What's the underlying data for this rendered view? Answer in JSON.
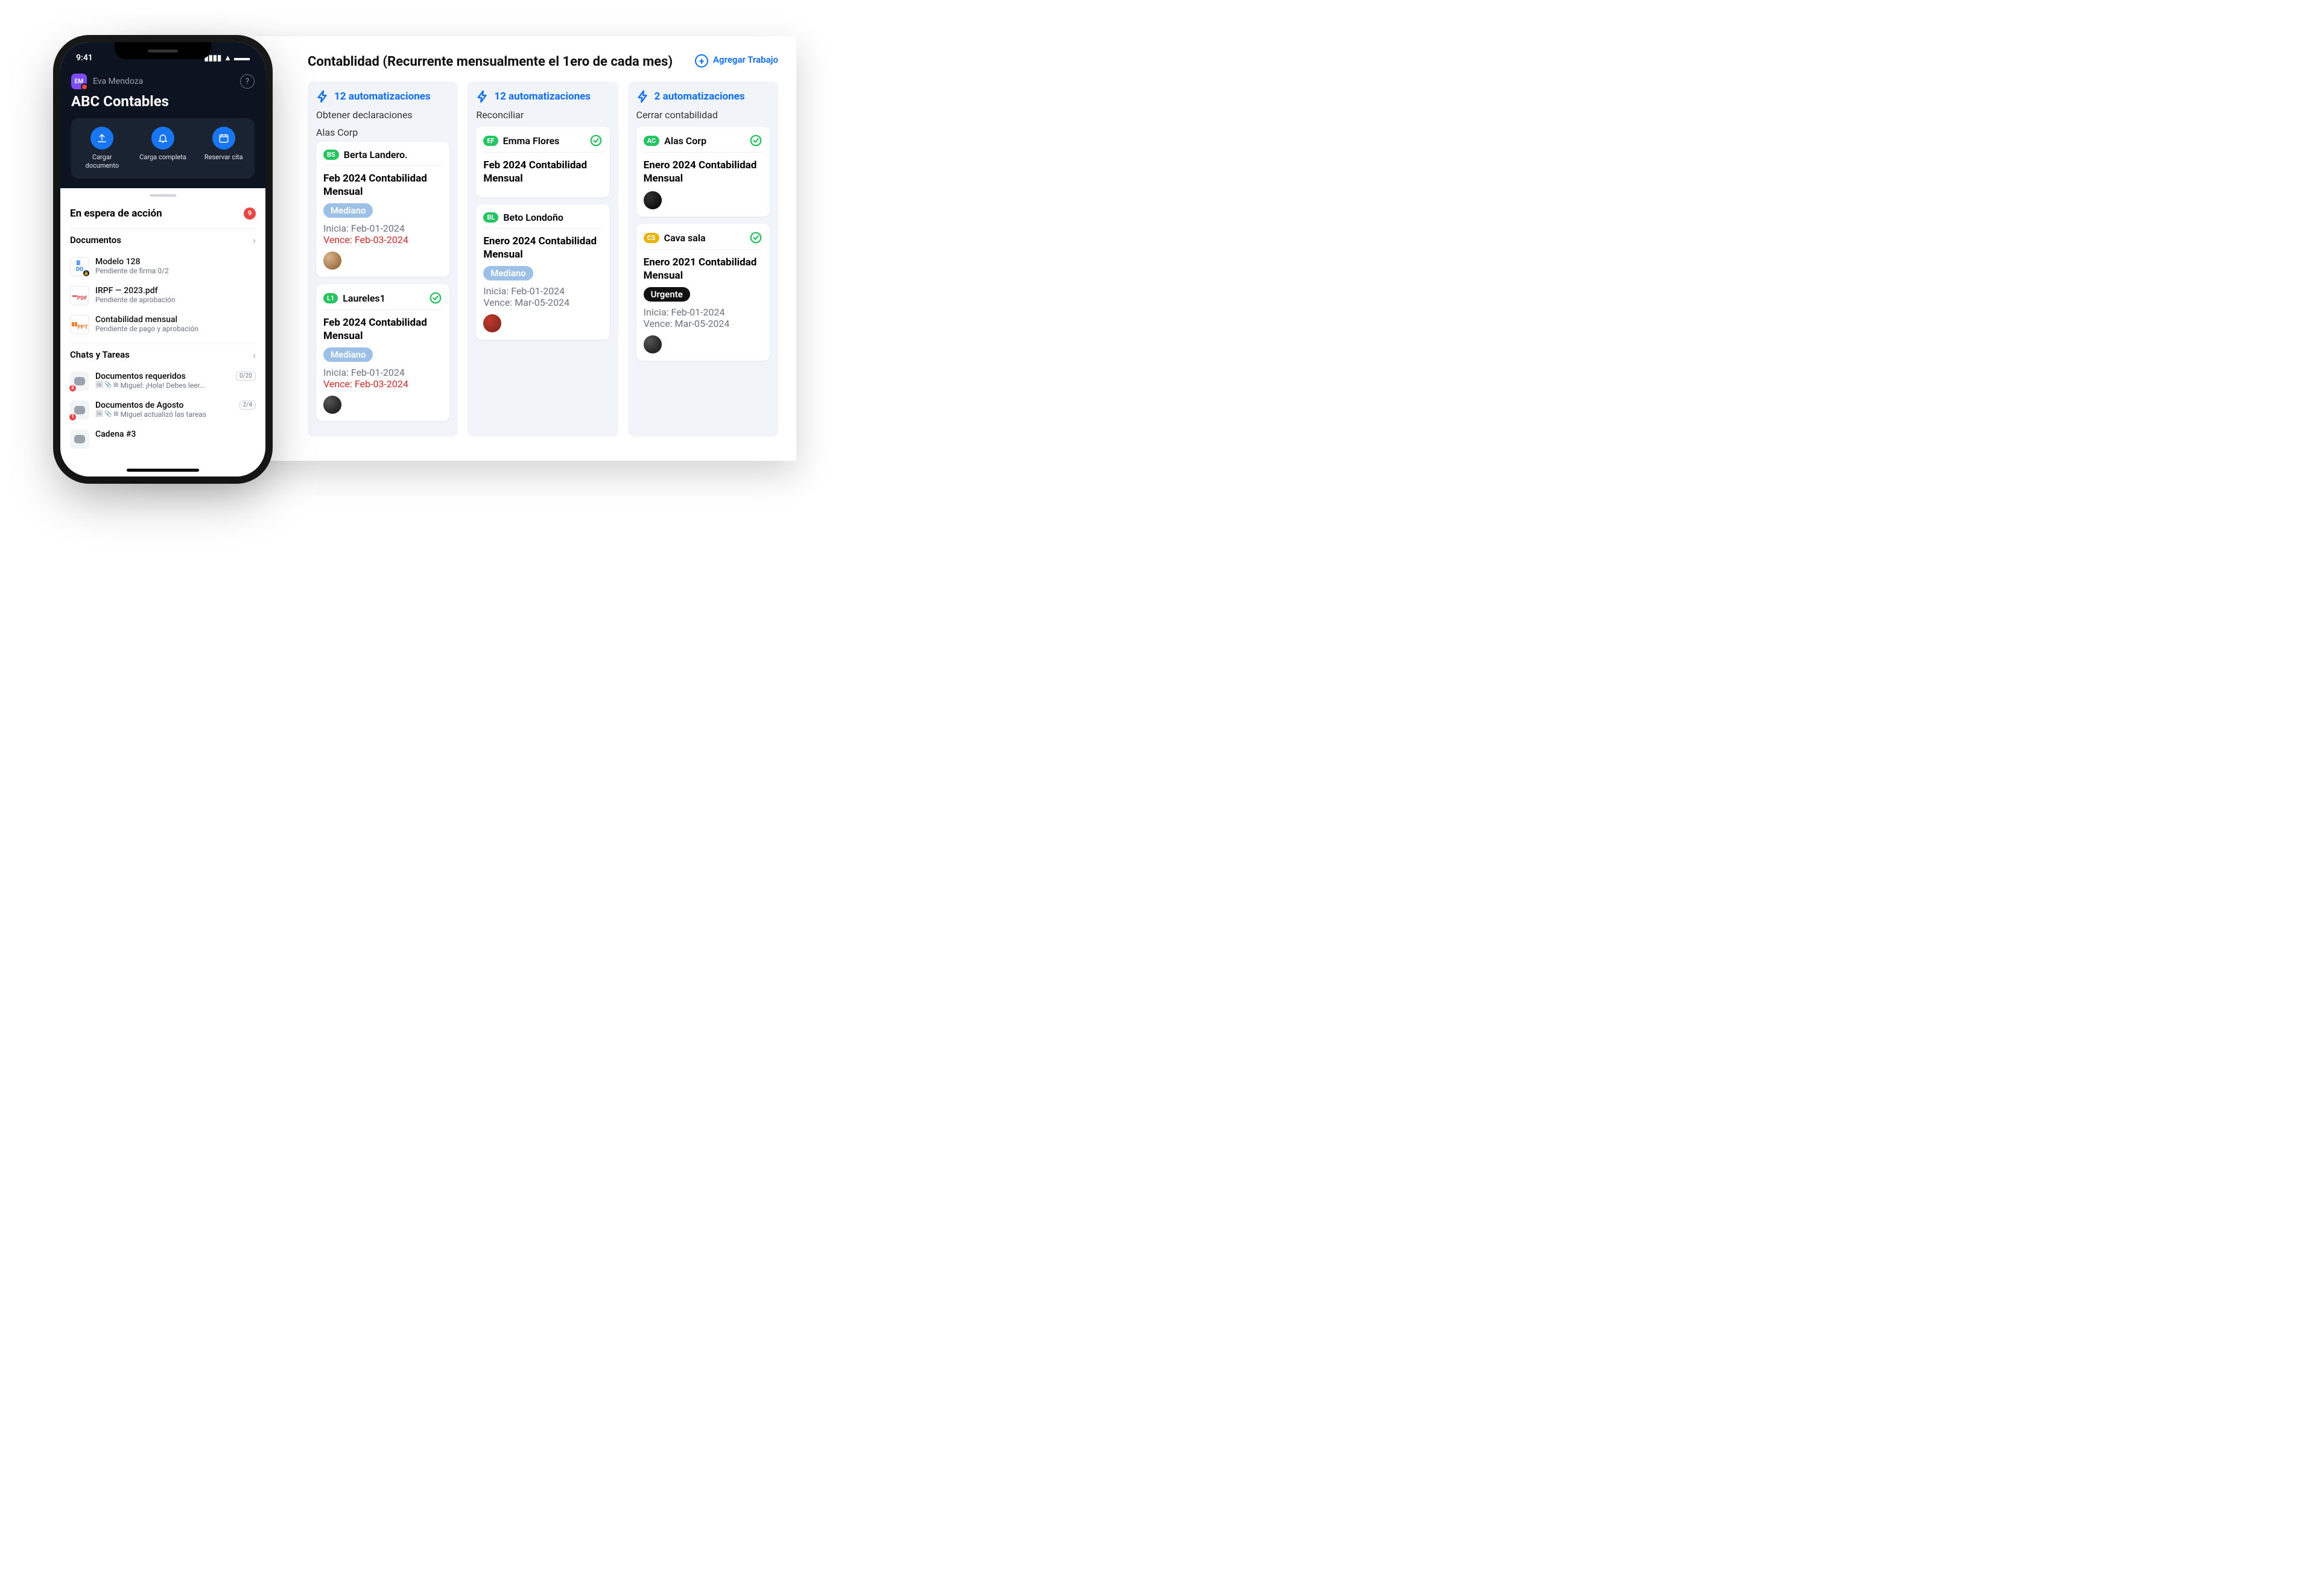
{
  "board": {
    "title": "Contablidad (Recurrente mensualmente el 1ero de cada mes)",
    "add_job": "Agregar Trabajo"
  },
  "columns": [
    {
      "automations": "12 automatizaciones",
      "subtitle": "Obtener declaraciones",
      "group": "Alas Corp",
      "cards": [
        {
          "chip": "BS",
          "chip_style": "green",
          "name": "Berta Landero.",
          "checked": false,
          "title": "Feb 2024 Contabilidad Mensual",
          "tag": "Mediano",
          "tag_style": "med",
          "start": "Inicia: Feb-01-2024",
          "due": "Vence: Feb-03-2024",
          "due_red": true,
          "avatar": "a1"
        },
        {
          "chip": "L1",
          "chip_style": "green",
          "name": "Laureles1",
          "checked": true,
          "title": "Feb 2024 Contabilidad Mensual",
          "tag": "Mediano",
          "tag_style": "med",
          "start": "Inicia: Feb-01-2024",
          "due": "Vence: Feb-03-2024",
          "due_red": true,
          "avatar": "a4"
        }
      ]
    },
    {
      "automations": "12 automatizaciones",
      "subtitle": "Reconciliar",
      "group": "",
      "cards": [
        {
          "chip": "EF",
          "chip_style": "green",
          "name": "Emma Flores",
          "checked": true,
          "title": "Feb 2024 Contabilidad Mensual",
          "tag": "",
          "tag_style": "",
          "start": "",
          "due": "",
          "due_red": false,
          "avatar": ""
        },
        {
          "chip": "BL",
          "chip_style": "green",
          "name": "Beto Londoño",
          "checked": false,
          "title": "Enero 2024 Contabilidad Mensual",
          "tag": "Mediano",
          "tag_style": "med",
          "start": "Inicia: Feb-01-2024",
          "due": "Vence: Mar-05-2024",
          "due_red": false,
          "avatar": "a2"
        }
      ]
    },
    {
      "automations": "2 automatizaciones",
      "subtitle": "Cerrar contabilidad",
      "group": "",
      "cards": [
        {
          "chip": "AC",
          "chip_style": "green",
          "name": "Alas Corp",
          "checked": true,
          "title": "Enero 2024 Contabilidad Mensual",
          "tag": "",
          "tag_style": "",
          "start": "",
          "due": "",
          "due_red": false,
          "avatar": "a3"
        },
        {
          "chip": "CS",
          "chip_style": "yellow",
          "name": "Cava sala",
          "checked": true,
          "title": "Enero 2021 Contabilidad Mensual",
          "tag": "Urgente",
          "tag_style": "urg",
          "start": "Inicia: Feb-01-2024",
          "due": "Vence: Mar-05-2024",
          "due_red": false,
          "avatar": "a4"
        }
      ]
    }
  ],
  "phone": {
    "time": "9:41",
    "user_initials": "EM",
    "user_name": "Eva Mendoza",
    "org": "ABC Contables",
    "actions": [
      {
        "label": "Cargar documento",
        "icon": "upload"
      },
      {
        "label": "Carga completa",
        "icon": "bell"
      },
      {
        "label": "Reservar cita",
        "icon": "calendar"
      }
    ],
    "pending_title": "En espera de acción",
    "pending_count": "9",
    "documents_title": "Documentos",
    "docs": [
      {
        "icon": "doc",
        "title": "Modelo 128",
        "sub": "Pendiente de firma 0/2",
        "locked": true
      },
      {
        "icon": "pdf",
        "title": "IRPF — 2023.pdf",
        "sub": "Pendiente de aprobación",
        "locked": false
      },
      {
        "icon": "ppt",
        "title": "Contabilidad mensual",
        "sub": "Pendiente de pago y aprobación",
        "locked": false
      }
    ],
    "chats_title": "Chats y Tareas",
    "chats": [
      {
        "count": "2",
        "title": "Documentos requeridos",
        "pill": "0/20",
        "sub": "Miguel: ¡Hola! Debes leer..."
      },
      {
        "count": "1",
        "title": "Documentos de Agosto",
        "pill": "2/4",
        "sub": "Miguel actualizó las tareas"
      },
      {
        "count": "",
        "title": "Cadena #3",
        "pill": "",
        "sub": ""
      }
    ]
  }
}
